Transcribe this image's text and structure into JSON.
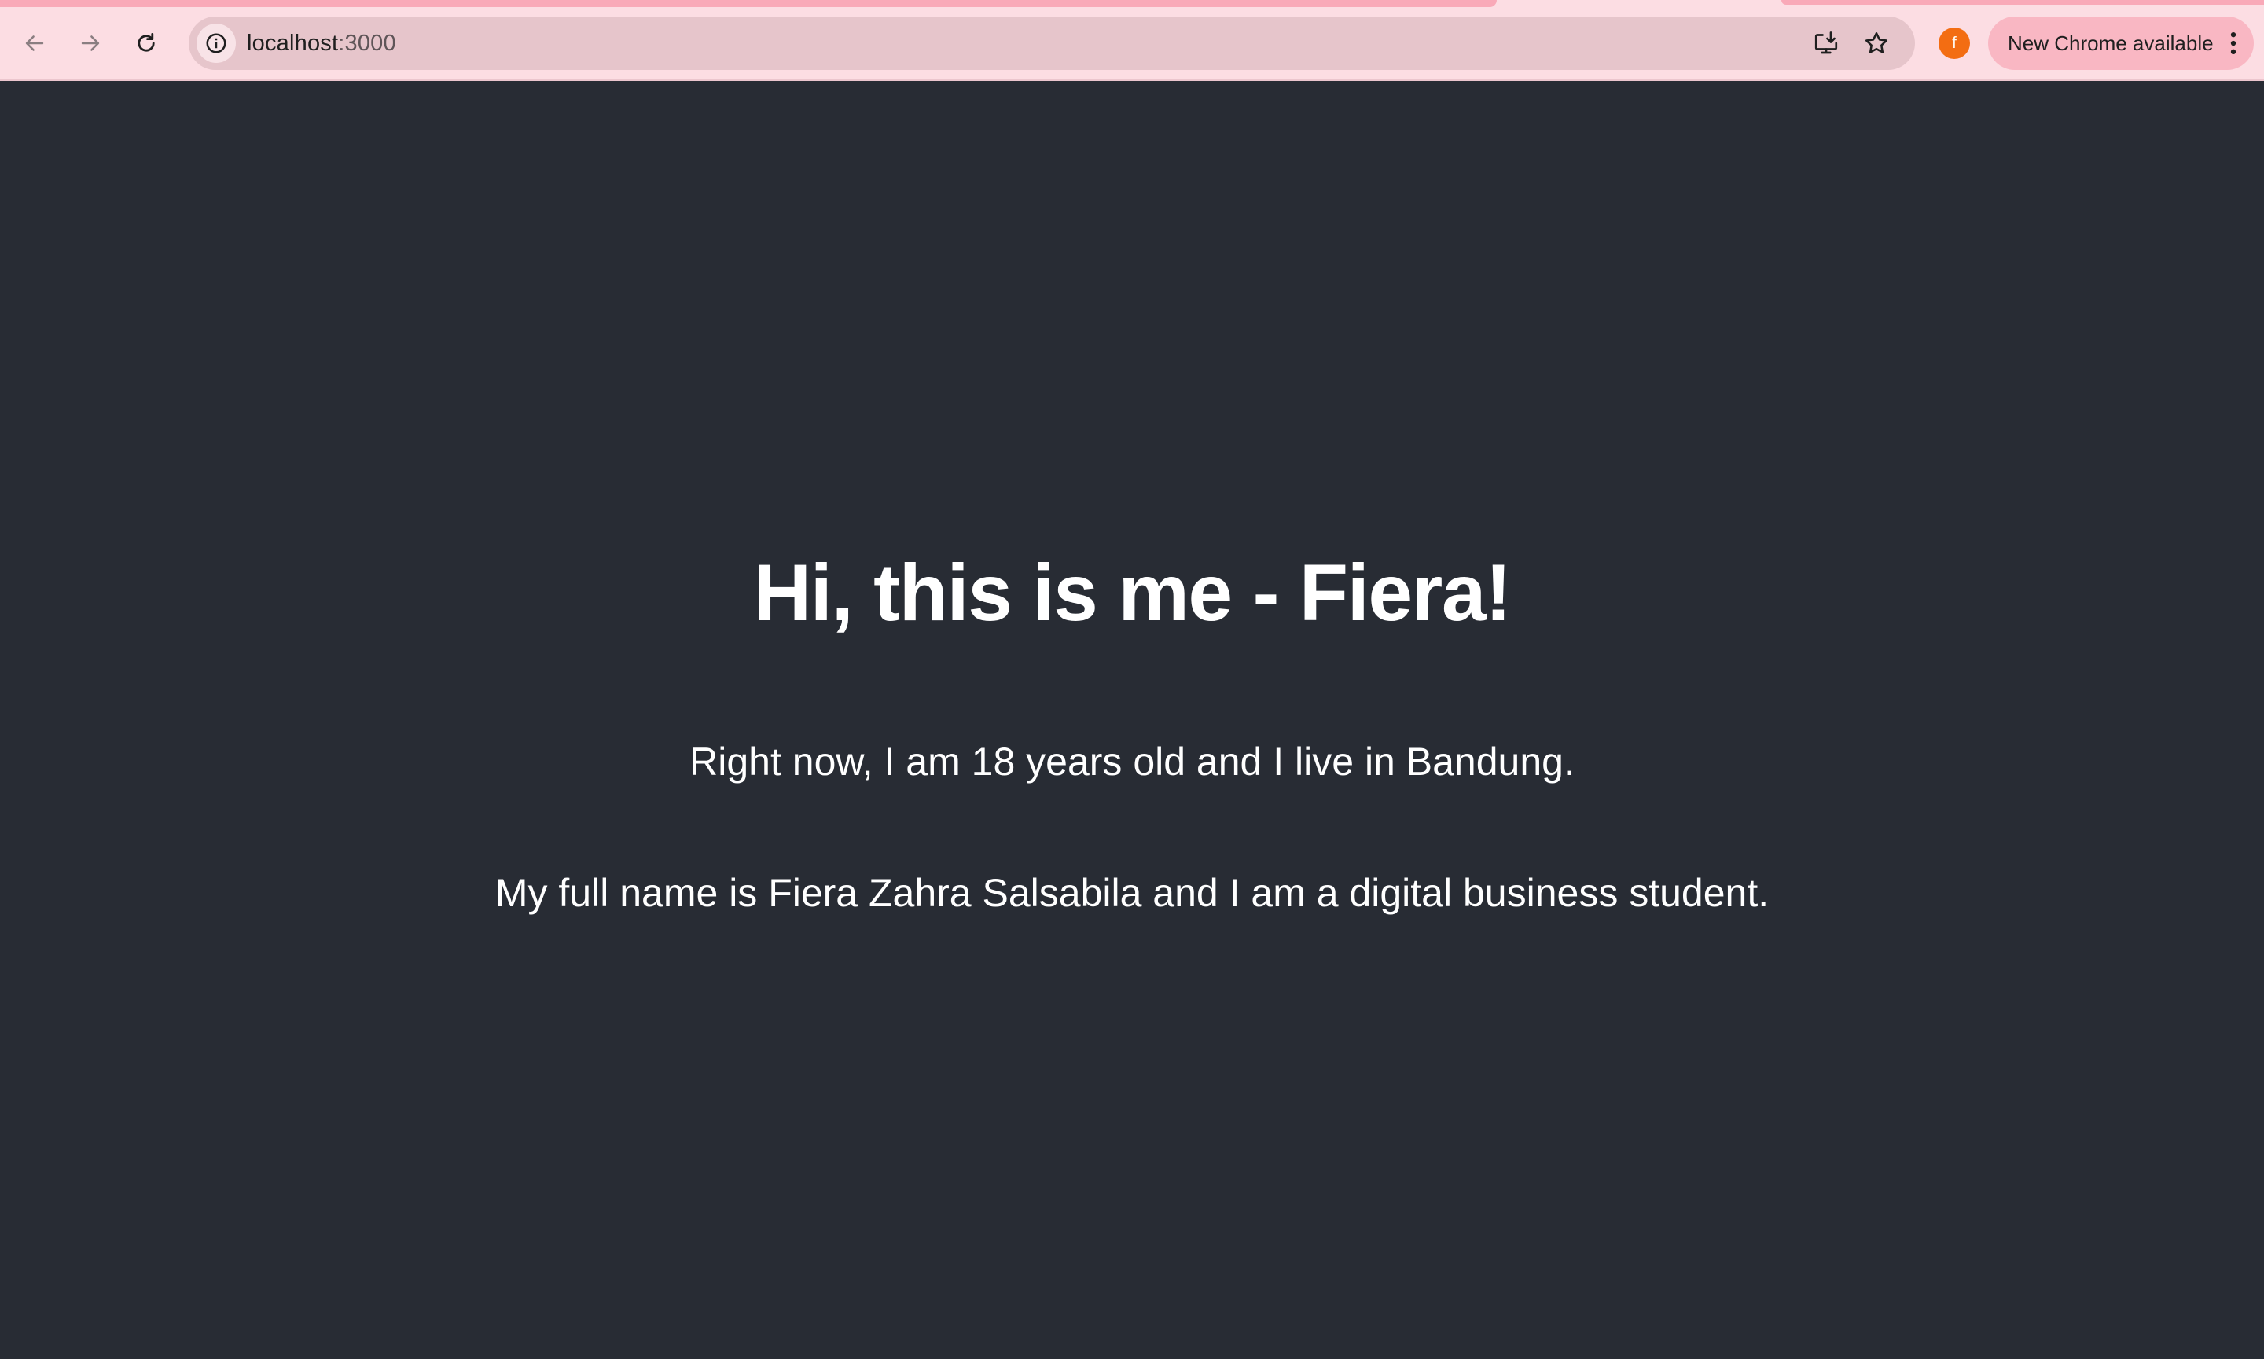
{
  "browser": {
    "url_host": "localhost",
    "url_port": ":3000",
    "profile_initial": "f",
    "update_chip_label": "New Chrome available",
    "colors": {
      "toolbar": "#fcdde3",
      "omnibox": "#e6c5cb",
      "update_chip": "#f9b7c3",
      "avatar": "#f36d12"
    },
    "icons": {
      "back": "arrow-left-icon",
      "forward": "arrow-right-icon",
      "reload": "reload-icon",
      "site_info": "info-icon",
      "install": "install-app-icon",
      "bookmark": "star-icon",
      "menu": "kebab-menu-icon"
    }
  },
  "page": {
    "background": "#282c34",
    "title": "Hi, this is me - Fiera!",
    "intro": "Right now, I am 18 years old and I live in Bandung.",
    "bio": "My full name is Fiera Zahra Salsabila and I am a digital business student."
  }
}
